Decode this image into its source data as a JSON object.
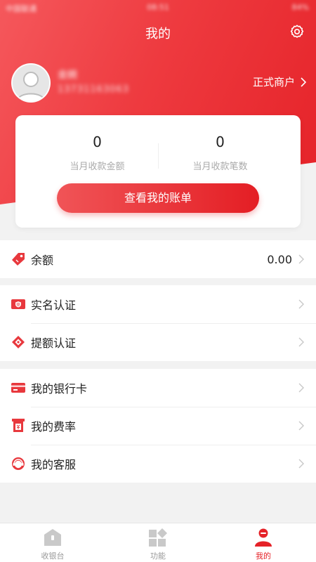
{
  "status_bar": {
    "carrier": "中国联通",
    "time": "08:51",
    "battery": "84%"
  },
  "nav": {
    "title": "我的"
  },
  "user": {
    "name": "金婉",
    "phone": "13731163063",
    "merchant_label": "正式商户"
  },
  "stats": {
    "amount_value": "0",
    "amount_label": "当月收款金额",
    "count_value": "0",
    "count_label": "当月收款笔数",
    "bill_button": "查看我的账单"
  },
  "balance": {
    "label": "余额",
    "value": "0.00"
  },
  "auth_group": [
    {
      "label": "实名认证"
    },
    {
      "label": "提额认证"
    }
  ],
  "my_group": [
    {
      "label": "我的银行卡"
    },
    {
      "label": "我的费率"
    },
    {
      "label": "我的客服"
    }
  ],
  "tabs": [
    {
      "label": "收银台",
      "active": false
    },
    {
      "label": "功能",
      "active": false
    },
    {
      "label": "我的",
      "active": true
    }
  ],
  "colors": {
    "accent": "#e52228",
    "inactive": "#999999"
  }
}
